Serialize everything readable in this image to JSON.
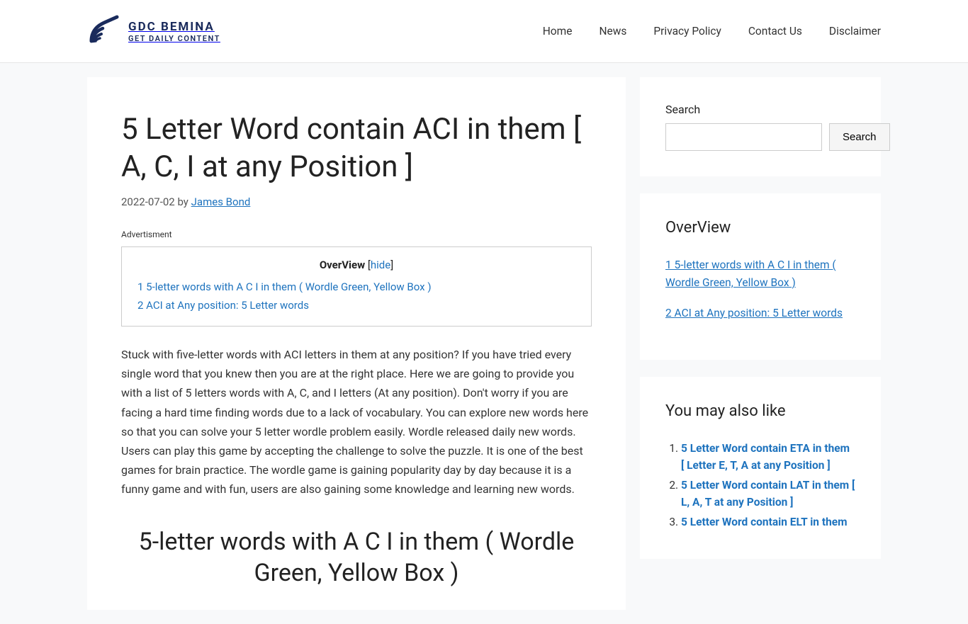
{
  "header": {
    "logo_title": "GDC BEMINA",
    "logo_subtitle": "GET DAILY CONTENT",
    "nav": [
      "Home",
      "News",
      "Privacy Policy",
      "Contact Us",
      "Disclaimer"
    ]
  },
  "article": {
    "title": "5 Letter Word contain ACI in them [ A, C, I at any Position ]",
    "date": "2022-07-02",
    "by": "by",
    "author": "James Bond",
    "advert_label": "Advertisment",
    "toc": {
      "title": "OverView",
      "hide_label": "hide",
      "items": [
        "1 5-letter words with A C I in them ( Wordle Green, Yellow Box )",
        "2 ACI at Any position: 5 Letter words"
      ]
    },
    "body": "Stuck with five-letter words with ACI letters in them at any position? If you have tried every single word that you knew then you are at the right place. Here we are going to provide you with a list of 5 letters words with A, C, and I letters (At any position). Don't worry if you are facing a hard time finding words due to a lack of vocabulary. You can explore new words here so that you can solve your 5 letter wordle problem easily. Wordle released daily new words. Users can play this game by accepting the challenge to solve the puzzle. It is one of the best games for brain practice. The wordle game is gaining popularity day by day because it is a funny game and with fun, users are also gaining some knowledge and learning new words.",
    "section_heading": "5-letter words with A C I in them ( Wordle Green, Yellow Box )"
  },
  "sidebar": {
    "search": {
      "label": "Search",
      "button": "Search"
    },
    "overview": {
      "title": "OverView",
      "items": [
        "1 5-letter words with A C I in them ( Wordle Green, Yellow Box )",
        "2 ACI at Any position: 5 Letter words"
      ]
    },
    "related": {
      "title": "You may also like",
      "items": [
        "5 Letter Word contain ETA in them [ Letter E, T, A at any Position ]",
        "5 Letter Word contain LAT in them [ L, A, T at any Position ]",
        "5 Letter Word contain ELT in them"
      ]
    }
  }
}
